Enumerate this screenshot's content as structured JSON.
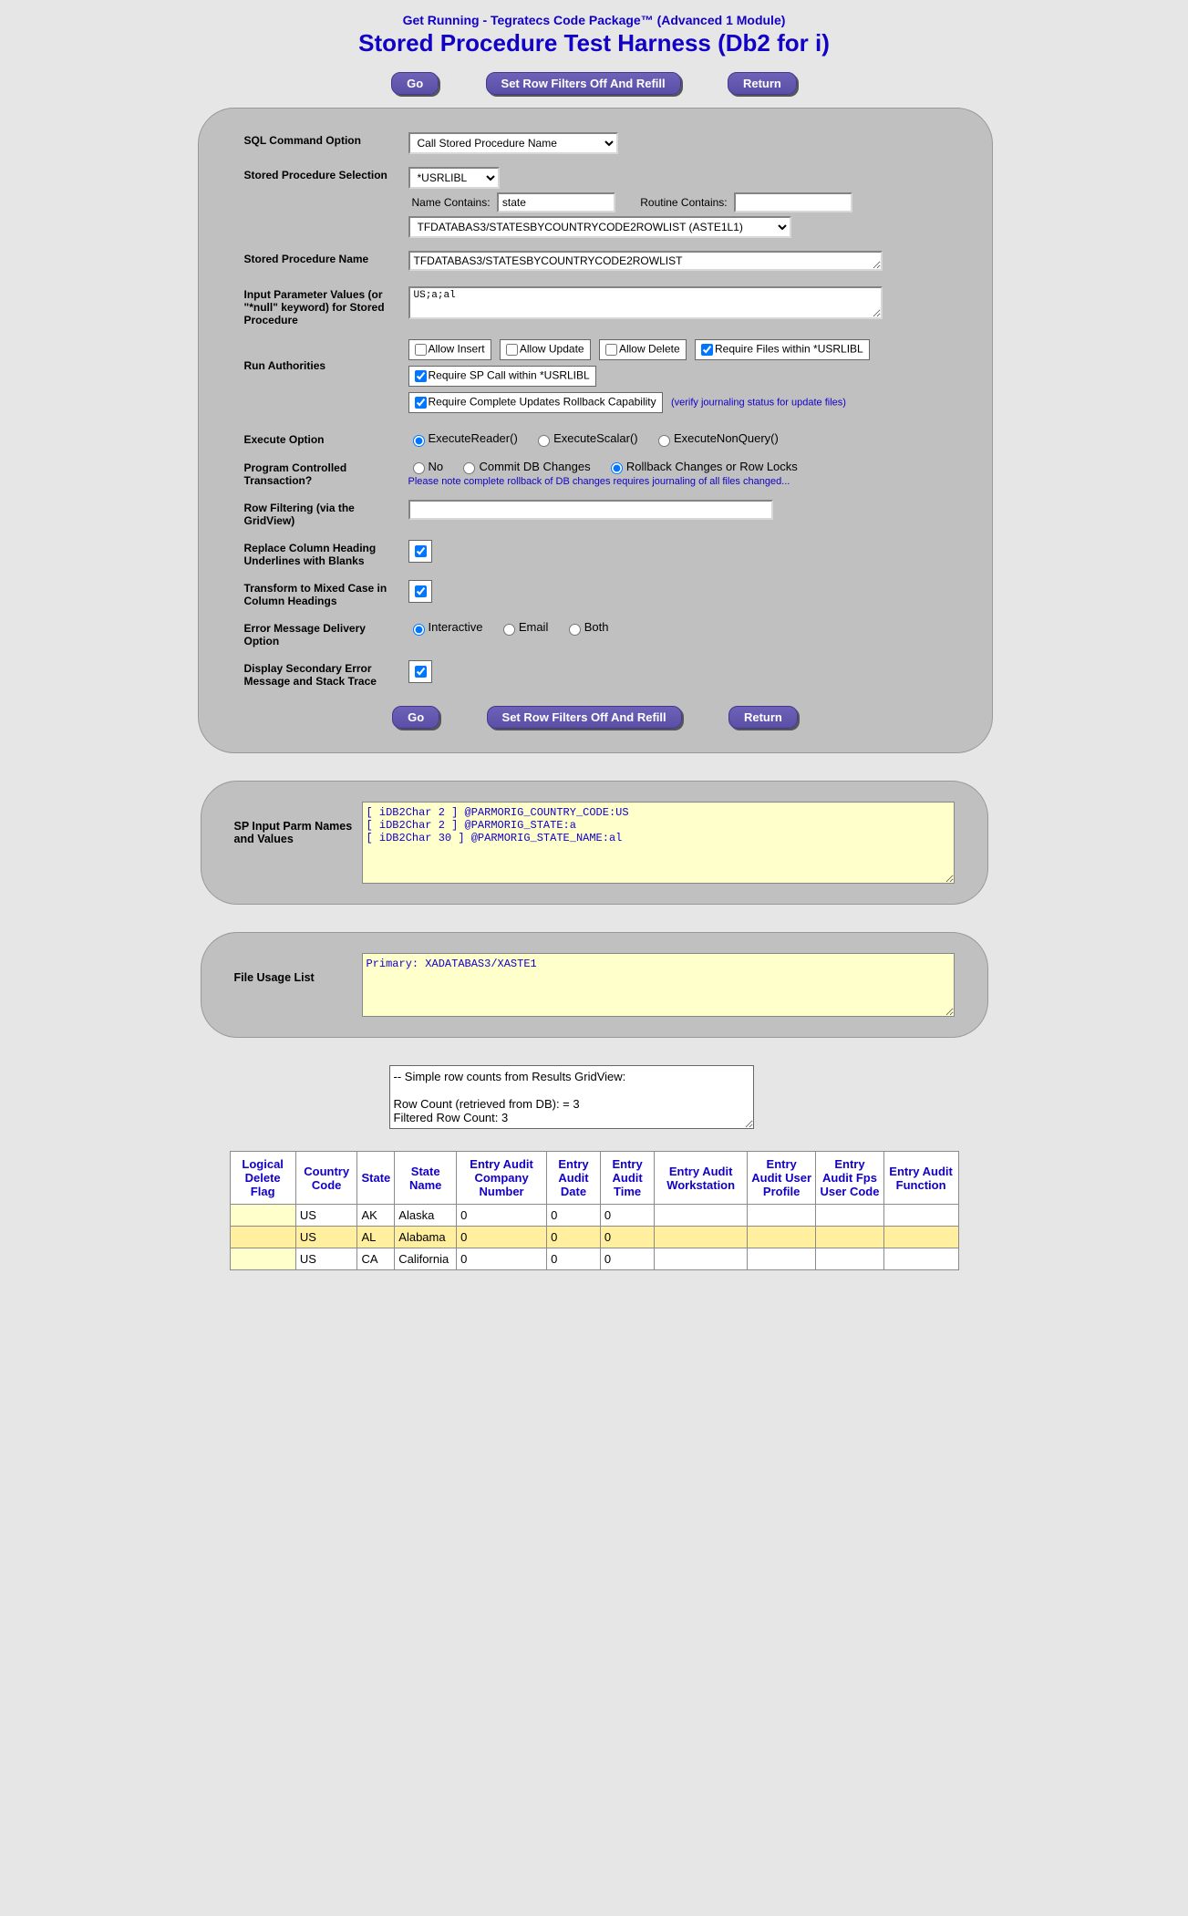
{
  "header": {
    "sup": "Get Running - Tegratecs Code Package™ (Advanced 1 Module)",
    "main": "Stored Procedure Test Harness (Db2 for i)"
  },
  "buttons": {
    "go": "Go",
    "refill": "Set Row Filters Off And Refill",
    "return": "Return"
  },
  "labels": {
    "sql_option": "SQL Command Option",
    "sp_selection": "Stored Procedure Selection",
    "name_contains": "Name Contains:",
    "routine_contains": "Routine Contains:",
    "sp_name": "Stored Procedure Name",
    "input_parms": "Input Parameter Values (or \"*null\" keyword) for Stored Procedure",
    "run_auth": "Run Authorities",
    "exec_option": "Execute Option",
    "pct": "Program Controlled Transaction?",
    "rowfilter": "Row Filtering (via the GridView)",
    "replace_heading": "Replace Column Heading Underlines with Blanks",
    "transform_mixed": "Transform to Mixed Case in Column Headings",
    "err_delivery": "Error Message Delivery Option",
    "display_secondary": "Display Secondary Error Message and Stack Trace",
    "sp_input_parms": "SP Input Parm Names and Values",
    "file_usage": "File Usage List"
  },
  "fields": {
    "sql_option_sel": "Call Stored Procedure Name",
    "lib_sel": "*USRLIBL",
    "name_contains_val": "state",
    "routine_contains_val": "",
    "sp_dropdown": "TFDATABAS3/STATESBYCOUNTRYCODE2ROWLIST (ASTE1L1)",
    "sp_name_val": "TFDATABAS3/STATESBYCOUNTRYCODE2ROWLIST",
    "input_parms_val": "US;a;al",
    "rowfilter_val": ""
  },
  "auth_checks": {
    "allow_insert": {
      "label": "Allow Insert",
      "checked": false
    },
    "allow_update": {
      "label": "Allow Update",
      "checked": false
    },
    "allow_delete": {
      "label": "Allow Delete",
      "checked": false
    },
    "require_files": {
      "label": "Require Files within *USRLIBL",
      "checked": true
    },
    "require_sp": {
      "label": "Require SP Call within *USRLIBL",
      "checked": true
    },
    "require_rollback": {
      "label": "Require Complete Updates Rollback Capability",
      "checked": true
    },
    "rollback_note": "(verify journaling status for update files)"
  },
  "exec_options": {
    "reader": "ExecuteReader()",
    "scalar": "ExecuteScalar()",
    "nonquery": "ExecuteNonQuery()",
    "selected": "reader"
  },
  "pct_options": {
    "no": "No",
    "commit": "Commit DB Changes",
    "rollback": "Rollback Changes or Row Locks",
    "selected": "rollback",
    "note": "Please note complete rollback of DB changes requires journaling of all files changed..."
  },
  "err_options": {
    "interactive": "Interactive",
    "email": "Email",
    "both": "Both",
    "selected": "interactive"
  },
  "bool_checks": {
    "replace_heading": true,
    "transform_mixed": true,
    "display_secondary": true
  },
  "sp_input_parms_text": "[ iDB2Char 2 ] @PARMORIG_COUNTRY_CODE:US\n[ iDB2Char 2 ] @PARMORIG_STATE:a\n[ iDB2Char 30 ] @PARMORIG_STATE_NAME:al",
  "file_usage_text": "Primary: XADATABAS3/XASTE1",
  "counts_text": "-- Simple row counts from Results GridView:\n\nRow Count (retrieved from DB): = 3\nFiltered Row Count: 3",
  "grid": {
    "headers": [
      "Logical Delete Flag",
      "Country Code",
      "State",
      "State Name",
      "Entry Audit Company Number",
      "Entry Audit Date",
      "Entry Audit Time",
      "Entry Audit Workstation",
      "Entry Audit User Profile",
      "Entry Audit Fps User Code",
      "Entry Audit Function"
    ],
    "rows": [
      {
        "hl": false,
        "cells": [
          "",
          "US",
          "AK",
          "Alaska",
          "0",
          "0",
          "0",
          "",
          "",
          "",
          ""
        ]
      },
      {
        "hl": true,
        "cells": [
          "",
          "US",
          "AL",
          "Alabama",
          "0",
          "0",
          "0",
          "",
          "",
          "",
          ""
        ]
      },
      {
        "hl": false,
        "cells": [
          "",
          "US",
          "CA",
          "California",
          "0",
          "0",
          "0",
          "",
          "",
          "",
          ""
        ]
      }
    ]
  }
}
